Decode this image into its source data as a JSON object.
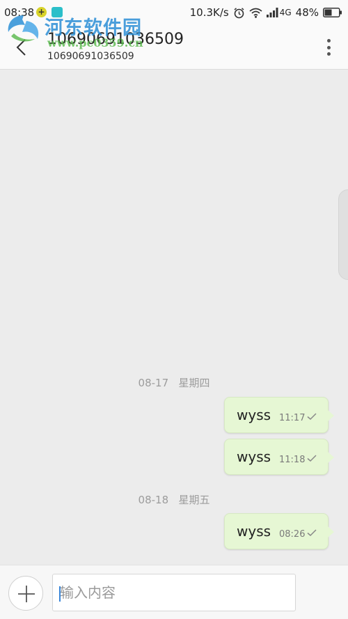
{
  "status_bar": {
    "time": "08:38",
    "network_speed": "10.3K/s",
    "network_type": "4G",
    "battery": "48%",
    "notif_icon": "+"
  },
  "watermark": {
    "text": "河东软件园",
    "url": "www.pc0359.cn"
  },
  "header": {
    "contact_name": "10690691036509",
    "contact_number": "10690691036509"
  },
  "conversation": {
    "groups": [
      {
        "date": "08-17",
        "weekday": "星期四",
        "messages": [
          {
            "text": "wyss",
            "time": "11:17",
            "status": "sent"
          },
          {
            "text": "wyss",
            "time": "11:18",
            "status": "sent"
          }
        ]
      },
      {
        "date": "08-18",
        "weekday": "星期五",
        "messages": [
          {
            "text": "wyss",
            "time": "08:26",
            "status": "sent"
          }
        ]
      }
    ]
  },
  "composer": {
    "placeholder": "输入内容",
    "value": ""
  },
  "colors": {
    "bubble": "#e6f7d4",
    "background": "#ececec",
    "header": "#fafafa"
  }
}
